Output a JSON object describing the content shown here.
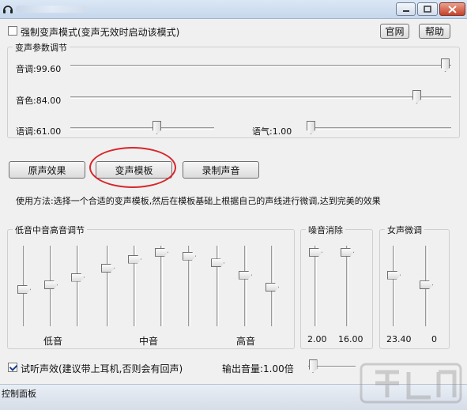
{
  "window": {
    "minimize_icon": "minimize-icon",
    "maximize_icon": "maximize-icon",
    "close_icon": "close-icon"
  },
  "force_mode": {
    "label": "强制变声模式(变声无效时启动该模式)",
    "checked": false
  },
  "buttons": {
    "website": "官网",
    "help": "帮助"
  },
  "params": {
    "title": "变声参数调节",
    "pitch": {
      "label": "音调:99.60",
      "value": 99.6
    },
    "timbre": {
      "label": "音色:84.00",
      "value": 84.0
    },
    "speed": {
      "label": "语调:61.00",
      "value": 61.0
    },
    "tone": {
      "label": "语气:1.00",
      "value": 1.0
    }
  },
  "actions": {
    "original": "原声效果",
    "template": "变声模板",
    "record": "录制声音"
  },
  "usage_text": "使用方法:选择一个合适的变声模板,然后在模板基础上根据自己的声线进行微调,达到完美的效果",
  "eq": {
    "title": "低音中音高音调节",
    "low": "低音",
    "mid": "中音",
    "high": "高音",
    "levels": [
      0.48,
      0.54,
      0.64,
      0.76,
      0.88,
      0.97,
      0.92,
      0.83,
      0.67,
      0.51
    ]
  },
  "noise": {
    "title": "噪音消除",
    "values": [
      "2.00",
      "16.00"
    ],
    "levels": [
      0.97,
      0.97
    ]
  },
  "female": {
    "title": "女声微调",
    "values": [
      "23.40",
      "0"
    ],
    "levels": [
      0.67,
      0.54
    ]
  },
  "preview": {
    "label": "试听声效(建议带上耳机,否则会有回声)",
    "checked": true
  },
  "output": {
    "label": "输出音量:1.00倍",
    "level": 0.05
  },
  "statusbar": {
    "text": "控制面板"
  },
  "watermark": {
    "text": "下载吧"
  }
}
